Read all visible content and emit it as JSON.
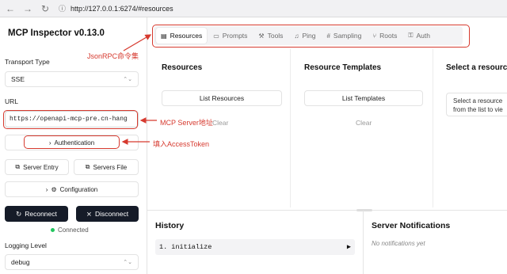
{
  "browser": {
    "back_icon": "←",
    "forward_icon": "→",
    "reload_icon": "↻",
    "info_icon": "ⓘ",
    "url": "http://127.0.0.1:6274/#resources"
  },
  "sidebar": {
    "title": "MCP Inspector v0.13.0",
    "transport_label": "Transport Type",
    "transport_value": "SSE",
    "url_label": "URL",
    "url_value": "https://openapi-mcp-pre.cn-hang",
    "authentication_label": "Authentication",
    "server_entry_label": "Server Entry",
    "servers_file_label": "Servers File",
    "configuration_label": "Configuration",
    "reconnect_label": "Reconnect",
    "disconnect_label": "Disconnect",
    "status_text": "Connected",
    "logging_label": "Logging Level",
    "logging_value": "debug"
  },
  "tabs": [
    {
      "label": "Resources",
      "icon": "resources-icon",
      "active": true
    },
    {
      "label": "Prompts",
      "icon": "prompts-icon",
      "active": false
    },
    {
      "label": "Tools",
      "icon": "tools-icon",
      "active": false
    },
    {
      "label": "Ping",
      "icon": "bell-icon",
      "active": false
    },
    {
      "label": "Sampling",
      "icon": "hash-icon",
      "active": false
    },
    {
      "label": "Roots",
      "icon": "roots-icon",
      "active": false
    },
    {
      "label": "Auth",
      "icon": "key-icon",
      "active": false
    }
  ],
  "resources_panel": {
    "resources_title": "Resources",
    "list_resources_label": "List Resources",
    "clear_left": "Clear",
    "templates_title": "Resource Templates",
    "list_templates_label": "List Templates",
    "clear_right": "Clear",
    "select_title": "Select a resource",
    "select_hint_line1": "Select a resource",
    "select_hint_line2": "from the list to vie"
  },
  "history": {
    "title": "History",
    "entry": "1. initialize",
    "expand_icon": "▶"
  },
  "notifications": {
    "title": "Server Notifications",
    "empty_text": "No notifications yet"
  },
  "annotations": {
    "tabs_note": "JsonRPC命令集",
    "url_note": "MCP Server地址",
    "auth_note": "填入AccessToken",
    "color": "#d63a2f"
  }
}
